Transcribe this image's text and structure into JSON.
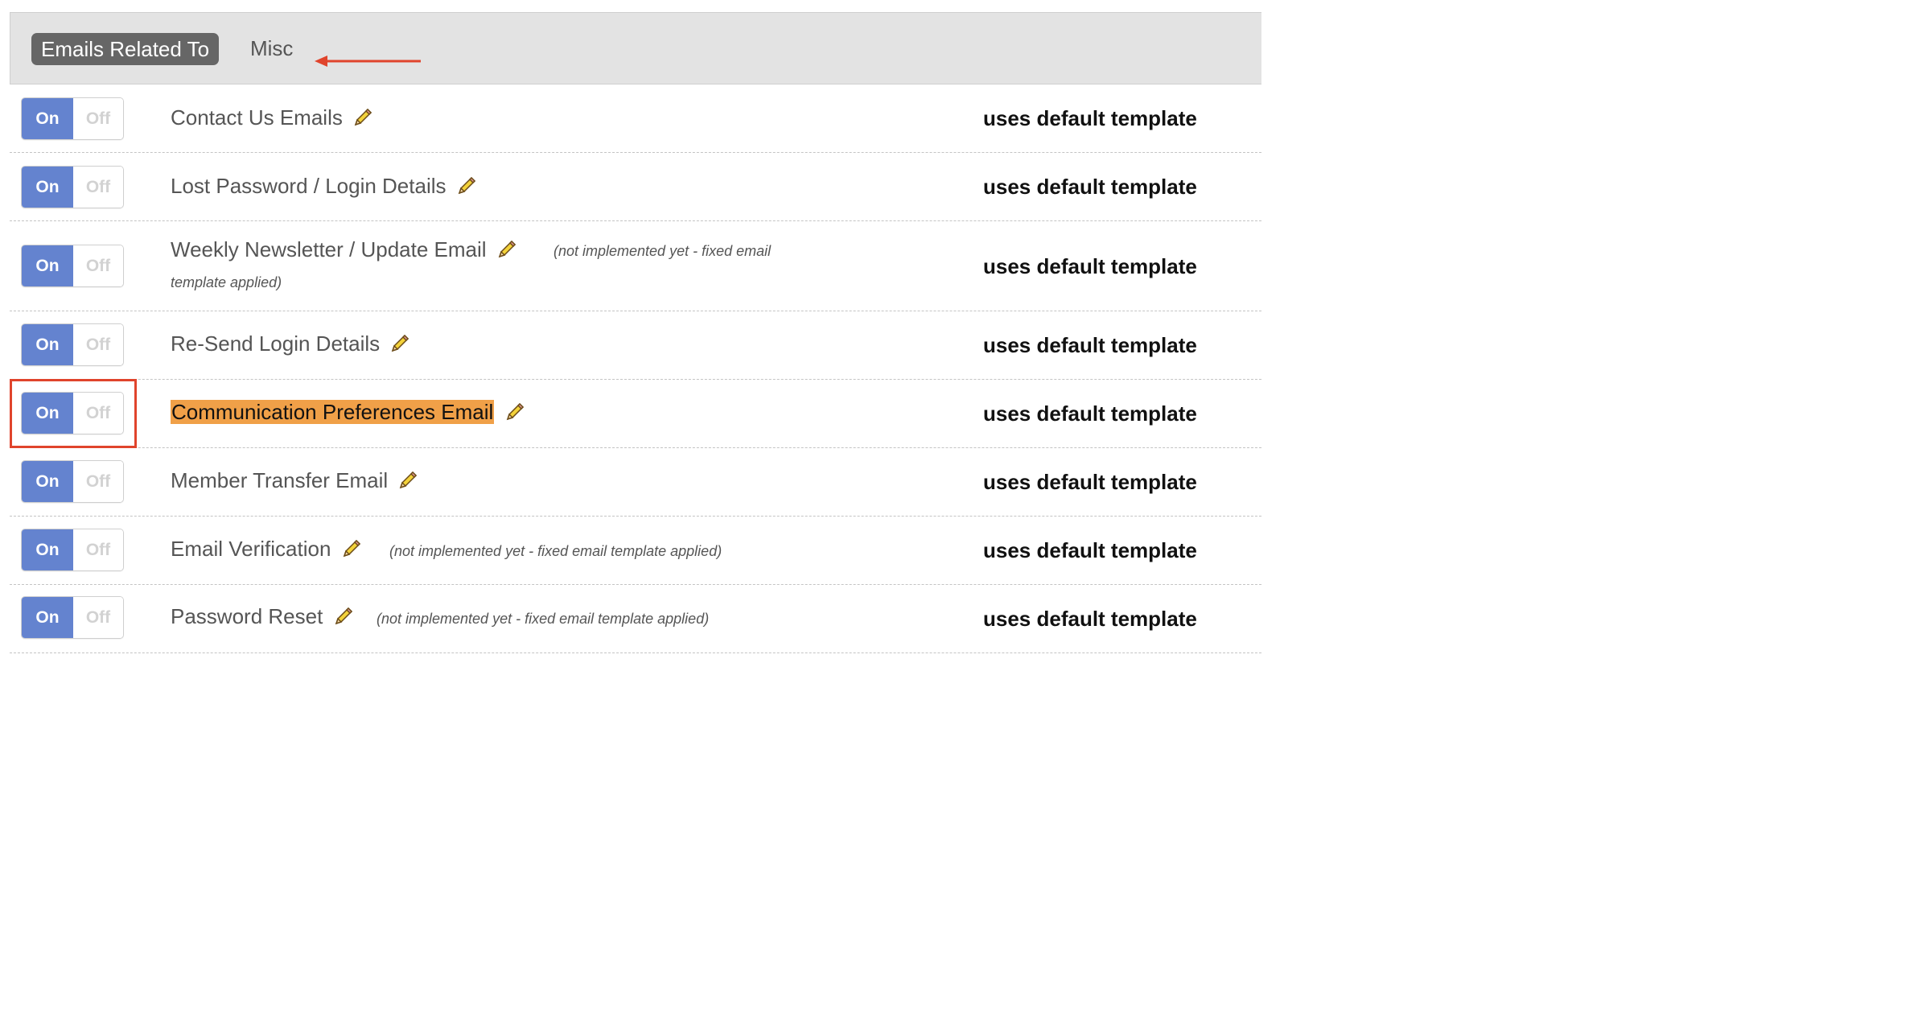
{
  "header": {
    "label": "Emails Related To",
    "value": "Misc",
    "arrow_color": "#e0442c"
  },
  "toggle": {
    "on_label": "On",
    "off_label": "Off",
    "on_color": "#6483cf"
  },
  "rows": [
    {
      "label": "Contact Us Emails",
      "template": "uses default template",
      "state": "on"
    },
    {
      "label": "Lost Password / Login Details",
      "template": "uses default template",
      "state": "on"
    },
    {
      "label": "Weekly Newsletter / Update Email",
      "note_part1": "(not implemented yet - fixed email",
      "note_part2": "template applied)",
      "template": "uses default template",
      "state": "on"
    },
    {
      "label": "Re-Send Login Details",
      "template": "uses default template",
      "state": "on"
    },
    {
      "label": "Communication Preferences Email",
      "template": "uses default template",
      "state": "on",
      "highlighted": true
    },
    {
      "label": "Member Transfer Email",
      "template": "uses default template",
      "state": "on"
    },
    {
      "label": "Email Verification",
      "note": "(not implemented yet - fixed email template applied)",
      "template": "uses default template",
      "state": "on"
    },
    {
      "label": "Password Reset",
      "note": "(not implemented yet - fixed email template applied)",
      "template": "uses default template",
      "state": "on"
    }
  ],
  "icons": {
    "edit": "pencil-icon",
    "arrow": "arrow-left-icon"
  },
  "colors": {
    "highlight_text_bg": "#f0a048",
    "annotation_box": "#e0442c"
  }
}
